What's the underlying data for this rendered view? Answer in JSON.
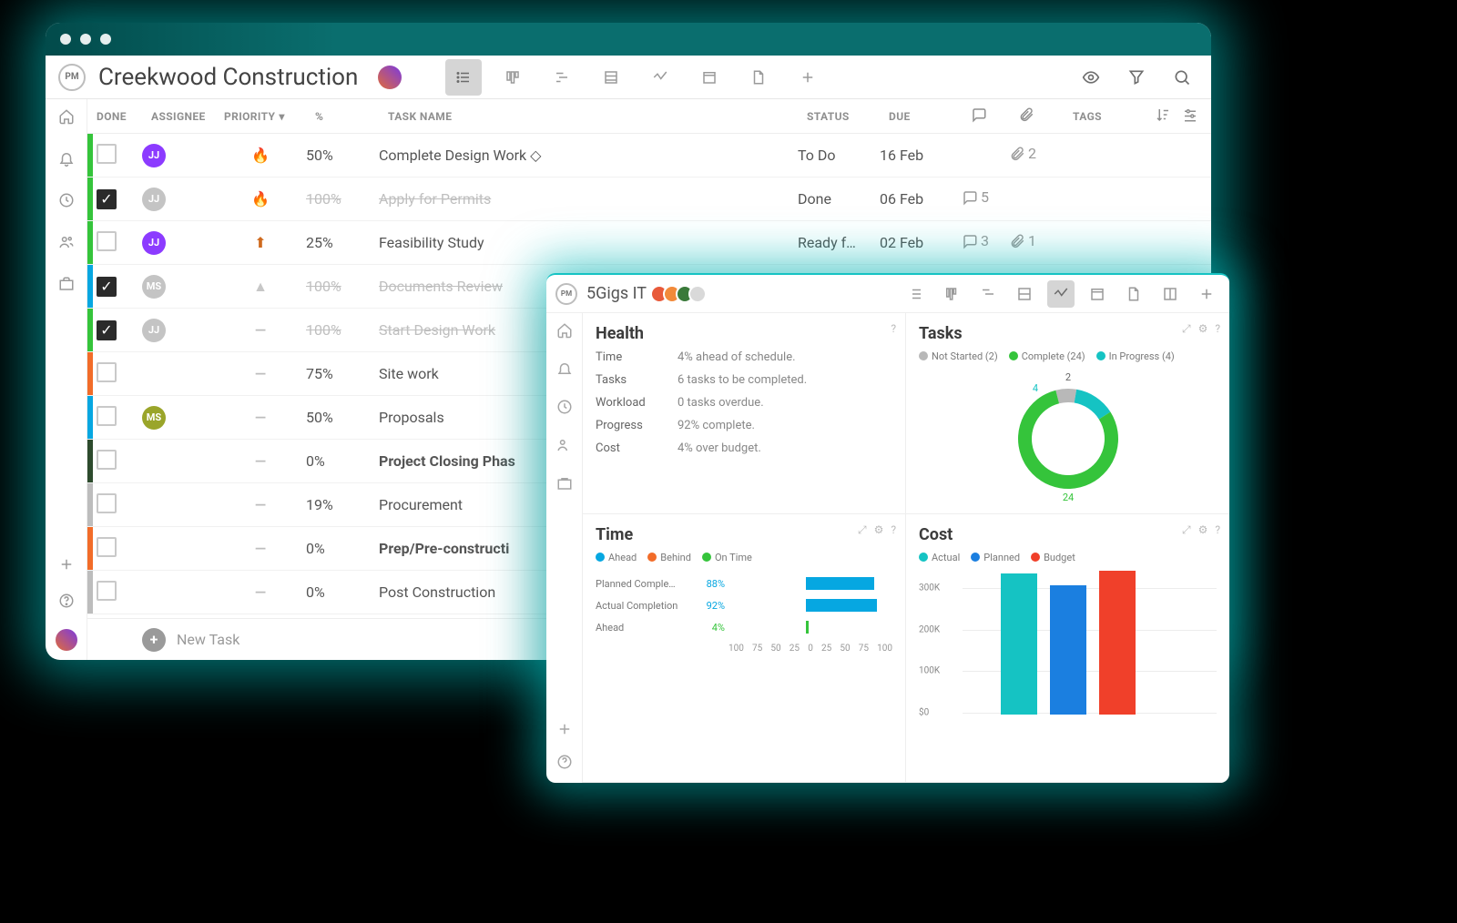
{
  "colors": {
    "green": "#35c43b",
    "blue": "#06a7e1",
    "orange": "#f26c29",
    "teal": "#15c3c3",
    "gray": "#b8b8b8",
    "red": "#e83c2e",
    "purple": "#8c3bff",
    "olive": "#9aa52a"
  },
  "back": {
    "project_title": "Creekwood Construction",
    "columns": {
      "done": "DONE",
      "assignee": "ASSIGNEE",
      "priority": "PRIORITY",
      "percent": "%",
      "name": "TASK NAME",
      "status": "STATUS",
      "due": "DUE",
      "tags": "TAGS"
    },
    "new_task_label": "New Task",
    "tasks": [
      {
        "edge": "#35c43b",
        "done": false,
        "assignee": "JJ",
        "assignee_bg": "#8c3bff",
        "priority": "flame-red",
        "percent": "50%",
        "name": "Complete Design Work ◇",
        "status": "To Do",
        "due": "16 Feb",
        "comments": "",
        "attach": "2",
        "bold": false,
        "strike": false
      },
      {
        "edge": "#35c43b",
        "done": true,
        "assignee": "JJ",
        "assignee_bg": "#c4c4c4",
        "priority": "flame-gray",
        "percent": "100%",
        "name": "Apply for Permits",
        "status": "Done",
        "due": "06 Feb",
        "comments": "5",
        "attach": "",
        "bold": false,
        "strike": true
      },
      {
        "edge": "#35c43b",
        "done": false,
        "assignee": "JJ",
        "assignee_bg": "#8c3bff",
        "priority": "arrow-up",
        "percent": "25%",
        "name": "Feasibility Study",
        "status": "Ready f…",
        "due": "02 Feb",
        "comments": "3",
        "attach": "1",
        "bold": false,
        "strike": false
      },
      {
        "edge": "#06a7e1",
        "done": true,
        "assignee": "MS",
        "assignee_bg": "#c4c4c4",
        "priority": "caret-gray",
        "percent": "100%",
        "name": "Documents Review",
        "status": "",
        "due": "",
        "comments": "",
        "attach": "",
        "bold": false,
        "strike": true
      },
      {
        "edge": "#35c43b",
        "done": true,
        "assignee": "JJ",
        "assignee_bg": "#c4c4c4",
        "priority": "none",
        "percent": "100%",
        "name": "Start Design Work",
        "status": "",
        "due": "",
        "comments": "",
        "attach": "",
        "bold": false,
        "strike": true
      },
      {
        "edge": "#f26c29",
        "done": false,
        "assignee": "",
        "assignee_bg": "",
        "priority": "none",
        "percent": "75%",
        "name": "Site work",
        "status": "",
        "due": "",
        "comments": "",
        "attach": "",
        "bold": false,
        "strike": false
      },
      {
        "edge": "#06a7e1",
        "done": false,
        "assignee": "MS",
        "assignee_bg": "#9aa52a",
        "priority": "none",
        "percent": "50%",
        "name": "Proposals",
        "status": "",
        "due": "",
        "comments": "",
        "attach": "",
        "bold": false,
        "strike": false
      },
      {
        "edge": "#2d4b2d",
        "done": false,
        "assignee": "",
        "assignee_bg": "",
        "priority": "none",
        "percent": "0%",
        "name": "Project Closing Phas",
        "status": "",
        "due": "",
        "comments": "",
        "attach": "",
        "bold": true,
        "strike": false
      },
      {
        "edge": "#bdbdbd",
        "done": false,
        "assignee": "",
        "assignee_bg": "",
        "priority": "none",
        "percent": "19%",
        "name": "Procurement",
        "status": "",
        "due": "",
        "comments": "",
        "attach": "",
        "bold": false,
        "strike": false
      },
      {
        "edge": "#f26c29",
        "done": false,
        "assignee": "",
        "assignee_bg": "",
        "priority": "none",
        "percent": "0%",
        "name": "Prep/Pre-constructi",
        "status": "",
        "due": "",
        "comments": "",
        "attach": "",
        "bold": true,
        "strike": false
      },
      {
        "edge": "#bdbdbd",
        "done": false,
        "assignee": "",
        "assignee_bg": "",
        "priority": "none",
        "percent": "0%",
        "name": "Post Construction",
        "status": "",
        "due": "",
        "comments": "",
        "attach": "",
        "bold": false,
        "strike": false
      }
    ]
  },
  "front": {
    "project_title": "5Gigs IT",
    "health": {
      "title": "Health",
      "rows": [
        {
          "k": "Time",
          "v": "4% ahead of schedule."
        },
        {
          "k": "Tasks",
          "v": "6 tasks to be completed."
        },
        {
          "k": "Workload",
          "v": "0 tasks overdue."
        },
        {
          "k": "Progress",
          "v": "92% complete."
        },
        {
          "k": "Cost",
          "v": "4% over budget."
        }
      ]
    },
    "tasks": {
      "title": "Tasks",
      "legend": [
        {
          "label": "Not Started (2)",
          "color": "#b8b8b8"
        },
        {
          "label": "Complete (24)",
          "color": "#35c43b"
        },
        {
          "label": "In Progress (4)",
          "color": "#15c3c3"
        }
      ]
    },
    "time": {
      "title": "Time",
      "legend": [
        {
          "label": "Ahead",
          "color": "#06a7e1"
        },
        {
          "label": "Behind",
          "color": "#f26c29"
        },
        {
          "label": "On Time",
          "color": "#35c43b"
        }
      ],
      "rows": [
        {
          "name": "Planned Comple…",
          "value": "88%",
          "value_color": "#06a7e1"
        },
        {
          "name": "Actual Completion",
          "value": "92%",
          "value_color": "#06a7e1"
        },
        {
          "name": "Ahead",
          "value": "4%",
          "value_color": "#35c43b"
        }
      ],
      "axis": [
        "100",
        "75",
        "50",
        "25",
        "0",
        "25",
        "50",
        "75",
        "100"
      ]
    },
    "cost": {
      "title": "Cost",
      "legend": [
        {
          "label": "Actual",
          "color": "#15c3c3"
        },
        {
          "label": "Planned",
          "color": "#1b7fe0"
        },
        {
          "label": "Budget",
          "color": "#f0402a"
        }
      ],
      "yticks": [
        "300K",
        "200K",
        "100K",
        "$0"
      ]
    }
  },
  "chart_data": [
    {
      "type": "pie",
      "title": "Tasks",
      "series": [
        {
          "name": "Not Started",
          "value": 2,
          "color": "#b8b8b8"
        },
        {
          "name": "In Progress",
          "value": 4,
          "color": "#15c3c3"
        },
        {
          "name": "Complete",
          "value": 24,
          "color": "#35c43b"
        }
      ],
      "labels_shown": [
        "2",
        "4",
        "24"
      ]
    },
    {
      "type": "bar",
      "title": "Time",
      "orientation": "horizontal-diverging",
      "xlabel": "",
      "ylabel": "",
      "xlim": [
        -100,
        100
      ],
      "series": [
        {
          "name": "Planned Completion",
          "value": 88,
          "color": "#06a7e1"
        },
        {
          "name": "Actual Completion",
          "value": 92,
          "color": "#06a7e1"
        },
        {
          "name": "Ahead",
          "value": 4,
          "color": "#35c43b"
        }
      ],
      "xticks": [
        100,
        75,
        50,
        25,
        0,
        25,
        50,
        75,
        100
      ]
    },
    {
      "type": "bar",
      "title": "Cost",
      "xlabel": "",
      "ylabel": "",
      "ylim": [
        0,
        350000
      ],
      "yticks": [
        0,
        100000,
        200000,
        300000
      ],
      "categories": [
        "Actual",
        "Planned",
        "Budget"
      ],
      "values": [
        340000,
        310000,
        345000
      ],
      "colors": [
        "#15c3c3",
        "#1b7fe0",
        "#f0402a"
      ]
    }
  ]
}
